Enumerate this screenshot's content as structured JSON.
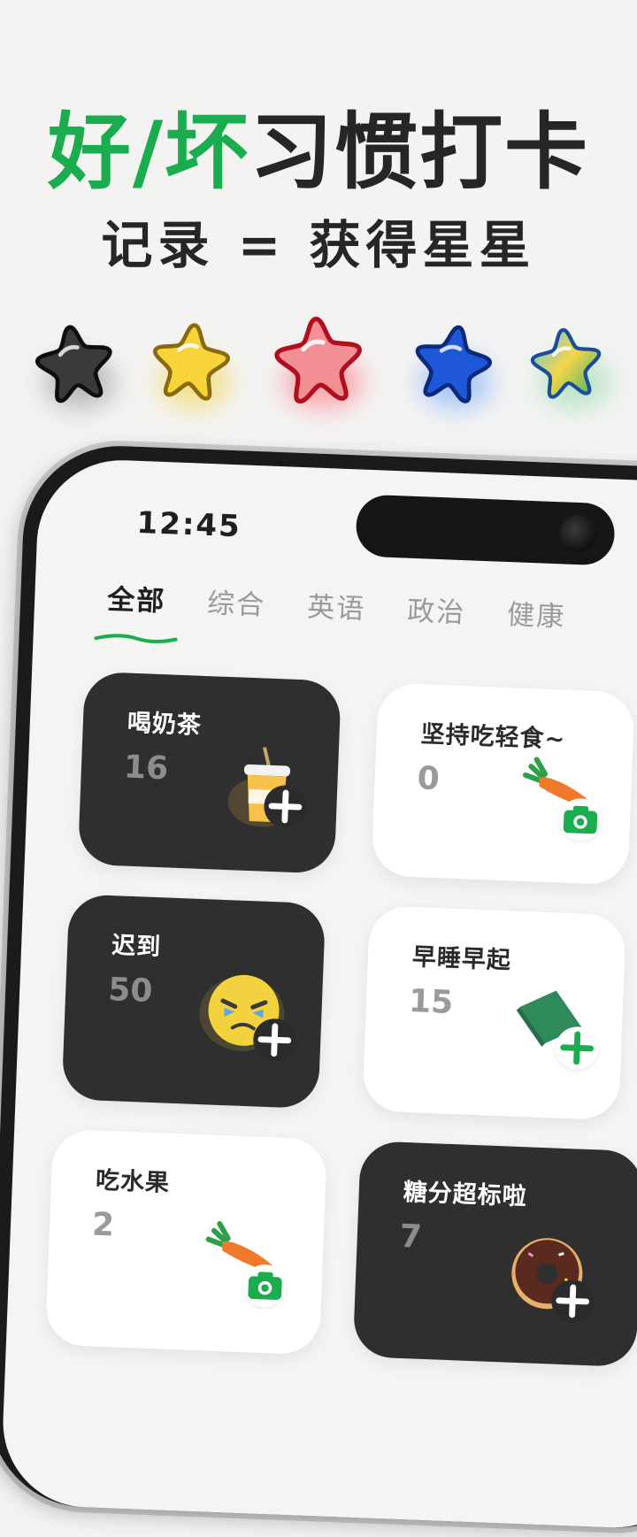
{
  "headline": {
    "green_text": "好/坏",
    "dark_text": "习惯打卡"
  },
  "subline": "记录 = 获得星星",
  "stars": [
    {
      "name": "black-star-icon",
      "color": "#3a3a3a",
      "outline": "#111111"
    },
    {
      "name": "yellow-star-icon",
      "color": "#f7d43a",
      "outline": "#8a6a10"
    },
    {
      "name": "red-star-icon",
      "color": "#f28f95",
      "outline": "#b0101e"
    },
    {
      "name": "blue-star-icon",
      "color": "#1f57d9",
      "outline": "#0b2a7a"
    },
    {
      "name": "rainbow-star-icon",
      "color": "#3fb6e8",
      "outline": "#1a4e9a"
    }
  ],
  "status_bar": {
    "time": "12:45"
  },
  "tabs": [
    {
      "label": "全部",
      "active": true
    },
    {
      "label": "综合",
      "active": false
    },
    {
      "label": "英语",
      "active": false
    },
    {
      "label": "政治",
      "active": false
    },
    {
      "label": "健康",
      "active": false
    }
  ],
  "habits": [
    {
      "title": "喝奶茶",
      "count": "16",
      "theme": "dark",
      "icon": "milk-tea-icon",
      "action": "add"
    },
    {
      "title": "坚持吃轻食~",
      "count": "0",
      "theme": "light",
      "icon": "carrot-icon",
      "action": "camera"
    },
    {
      "title": "迟到",
      "count": "50",
      "theme": "dark",
      "icon": "crying-emoji-icon",
      "action": "add"
    },
    {
      "title": "早睡早起",
      "count": "15",
      "theme": "light",
      "icon": "pillow-icon",
      "action": "add"
    },
    {
      "title": "吃水果",
      "count": "2",
      "theme": "light",
      "icon": "carrot-icon",
      "action": "camera"
    },
    {
      "title": "糖分超标啦",
      "count": "7",
      "theme": "dark",
      "icon": "donut-icon",
      "action": "add"
    }
  ],
  "accent_color": "#1aac4e"
}
